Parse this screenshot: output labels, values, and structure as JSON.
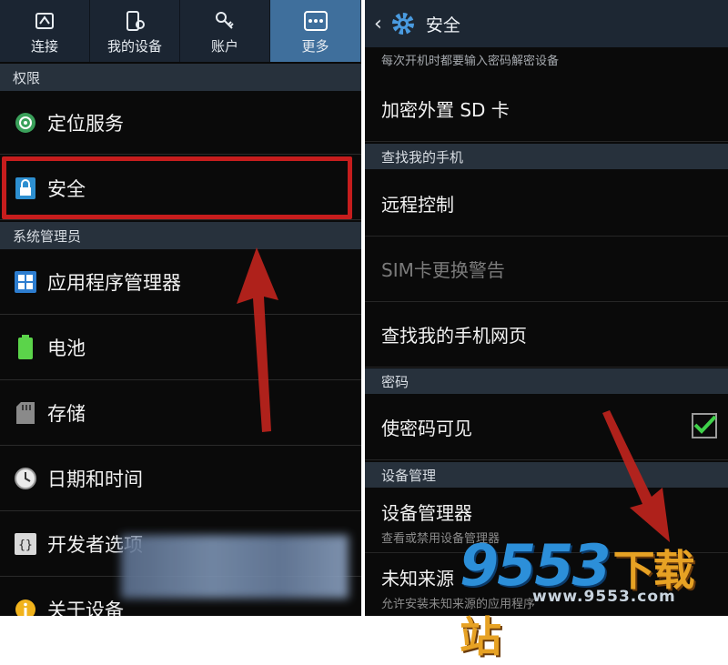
{
  "left_panel": {
    "tabs": [
      {
        "label": "连接",
        "icon": "connect-icon"
      },
      {
        "label": "我的设备",
        "icon": "device-icon"
      },
      {
        "label": "账户",
        "icon": "key-icon"
      },
      {
        "label": "更多",
        "icon": "more-icon",
        "active": true
      }
    ],
    "section_permissions": "权限",
    "location": "定位服务",
    "security": "安全",
    "section_system": "系统管理员",
    "app_manager": "应用程序管理器",
    "battery": "电池",
    "storage": "存储",
    "datetime": "日期和时间",
    "developer": "开发者选项",
    "about": "关于设备"
  },
  "right_panel": {
    "header_title": "安全",
    "hint": "每次开机时都要输入密码解密设备",
    "encrypt_sd": "加密外置 SD 卡",
    "section_find": "查找我的手机",
    "remote_control": "远程控制",
    "sim_alert": "SIM卡更换警告",
    "find_web": "查找我的手机网页",
    "section_password": "密码",
    "show_password": "使密码可见",
    "show_password_checked": true,
    "section_device_admin": "设备管理",
    "device_admin": "设备管理器",
    "device_admin_sub": "查看或禁用设备管理器",
    "unknown_sources": "未知来源",
    "unknown_sources_sub": "允许安装未知来源的应用程序"
  },
  "watermark": {
    "brand": "9553",
    "brand_cn": "下载站",
    "url": "www.9553.com"
  },
  "colors": {
    "highlight": "#c61d1d",
    "arrow": "#b8231c",
    "active_tab": "#3f6f9c",
    "checkbox_check": "#3fd14a"
  }
}
